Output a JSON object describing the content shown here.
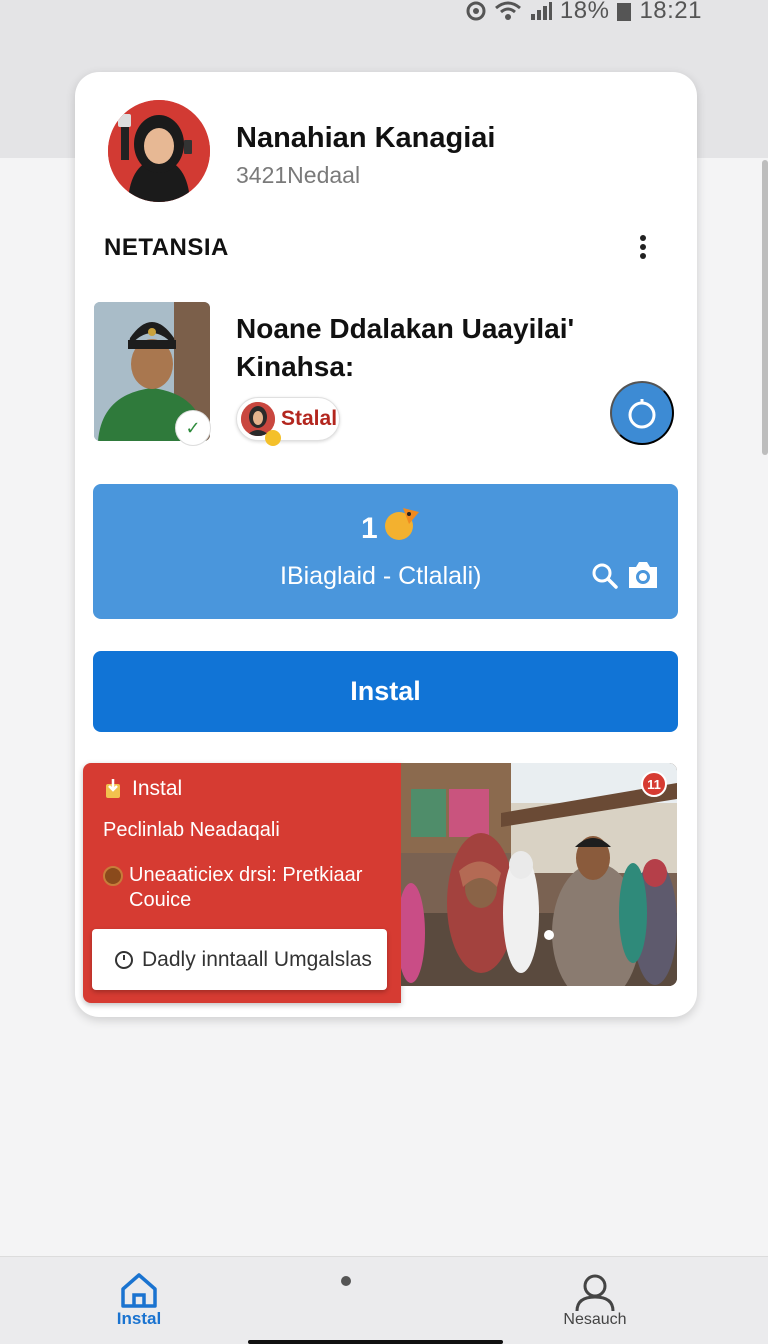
{
  "status_bar": {
    "battery_percent": "18%",
    "time": "18:21"
  },
  "profile": {
    "name": "Nanahian Kanagiai",
    "subtitle": "3421Nedaal"
  },
  "section": {
    "title": "NETANSIA"
  },
  "post": {
    "title": "Noane Ddalakan Uaayilai' Kinahsa:",
    "chip_label": "Stalal"
  },
  "search_panel": {
    "count": "1",
    "input_text": "IBiaglaid - Ctlalali)"
  },
  "install_button": {
    "label": "Instal"
  },
  "promo": {
    "tag": "Instal",
    "headline": "Peclinlab Neadaqali",
    "detail": "Uneaaticiex drsi: Pretkiaar Couice",
    "action_label": "Dadly inntaall Umgalslas",
    "badge": "11"
  },
  "bottom_nav": {
    "items": [
      {
        "label": "Instal",
        "icon": "home-icon",
        "active": true
      },
      {
        "label": "Nesauch",
        "icon": "person-icon",
        "active": false
      }
    ]
  },
  "colors": {
    "accent_blue": "#1174d6",
    "panel_blue": "#4a96dc",
    "promo_red": "#d63b32"
  }
}
